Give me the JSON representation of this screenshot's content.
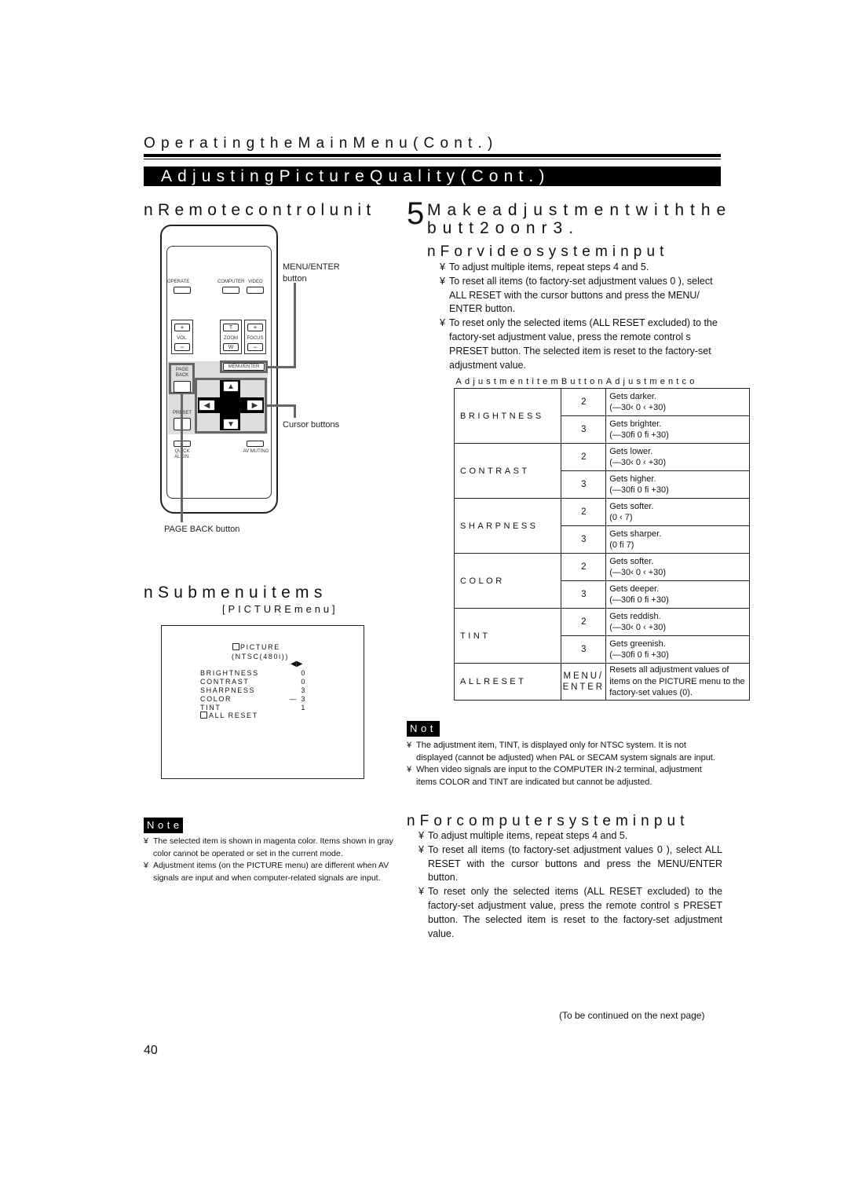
{
  "header": {
    "running_title": "OperatingtheMainMenu(Cont.)",
    "section_banner": "AdjustingPictureQuality(Cont.)"
  },
  "remote_section": {
    "heading": "nRemotecontrolunit",
    "buttons": {
      "operate": "OPERATE",
      "computer": "COMPUTER",
      "video": "VIDEO",
      "vol_plus": "+",
      "vol_label": "VOL.",
      "vol_minus": "−",
      "zoom_t": "T",
      "zoom_label": "ZOOM",
      "zoom_w": "W",
      "focus_plus": "+",
      "focus_label": "FOCUS",
      "focus_minus": "−",
      "menu_enter": "MENU/ENTER",
      "page_back": "PAGE BACK",
      "preset": "PRESET",
      "up": "▲",
      "down": "▼",
      "left": "◀",
      "right": "▶",
      "quick_align": "QUICK ALIGN.",
      "av_muting": "AV MUTING"
    },
    "callouts": {
      "menu_enter_line1": "MENU/ENTER",
      "menu_enter_line2": "button",
      "cursor": "Cursor buttons",
      "page_back": "PAGE BACK button"
    }
  },
  "step": {
    "number": "5",
    "title_line1": "Makeadjustmentwiththe",
    "title_line2": "butt2oonr3."
  },
  "video_input": {
    "heading": "nForvideosysteminput",
    "bullet_symbol": "¥",
    "bullets": [
      "To adjust multiple items, repeat steps 4 and 5.",
      "To reset all items (to factory-set adjustment values  0 ), select ALL RESET with the cursor buttons and press the MENU/ ENTER button.",
      "To reset only the selected items (ALL RESET excluded) to the factory-set adjustment value, press the remote control s PRESET button. The selected item is reset to the factory-set adjustment value."
    ]
  },
  "table": {
    "headers": [
      "Adjustmentitem",
      "Button",
      "Adjustmentco"
    ],
    "rows": [
      {
        "item": "BRIGHTNESS",
        "entries": [
          {
            "button": "2",
            "result": "Gets darker.",
            "range": "(—30‹  0 ‹  +30)"
          },
          {
            "button": "3",
            "result": "Gets brighter.",
            "range": "(—30fi  0 fi  +30)"
          }
        ]
      },
      {
        "item": "CONTRAST",
        "entries": [
          {
            "button": "2",
            "result": "Gets lower.",
            "range": "(—30‹  0 ‹  +30)"
          },
          {
            "button": "3",
            "result": "Gets higher.",
            "range": "(—30fi  0 fi  +30)"
          }
        ]
      },
      {
        "item": "SHARPNESS",
        "entries": [
          {
            "button": "2",
            "result": "Gets softer.",
            "range": "(0 ‹  7)"
          },
          {
            "button": "3",
            "result": "Gets sharper.",
            "range": "(0 fi  7)"
          }
        ]
      },
      {
        "item": "COLOR",
        "entries": [
          {
            "button": "2",
            "result": "Gets softer.",
            "range": "(—30‹  0 ‹  +30)"
          },
          {
            "button": "3",
            "result": "Gets deeper.",
            "range": "(—30fi  0 fi  +30)"
          }
        ]
      },
      {
        "item": "TINT",
        "entries": [
          {
            "button": "2",
            "result": "Gets reddish.",
            "range": "(—30‹  0 ‹  +30)"
          },
          {
            "button": "3",
            "result": "Gets greenish.",
            "range": "(—30fi  0 fi  +30)"
          }
        ]
      }
    ],
    "all_reset": {
      "item": "ALLRESET",
      "button_line1": "MENU/",
      "button_line2": "ENTER",
      "result": "Resets all adjustment values of items on the PICTURE menu to the factory-set values (0)."
    }
  },
  "video_note": {
    "badge": "Not",
    "bullets": [
      "The adjustment item, TINT, is displayed only for NTSC system. It is not displayed (cannot be adjusted) when PAL or SECAM system signals are input.",
      "When video signals are input to the COMPUTER IN-2 terminal, adjustment items  COLOR  and  TINT  are indicated but cannot be adjusted."
    ]
  },
  "submenu": {
    "heading": "nSubmenuitems",
    "subheading": "[PICTUREmenu]",
    "osd": {
      "title": "PICTURE",
      "signal": "(NTSC(480i))",
      "arrows": "◀▶",
      "items": [
        {
          "label": "BRIGHTNESS",
          "value": "0"
        },
        {
          "label": "CONTRAST",
          "value": "0"
        },
        {
          "label": "SHARPNESS",
          "value": "3"
        },
        {
          "label": "COLOR",
          "value": "— 3"
        },
        {
          "label": "TINT",
          "value": "1"
        }
      ],
      "all_reset": "ALL RESET"
    }
  },
  "left_note": {
    "badge": "Note",
    "bullets": [
      "The selected item is shown in magenta color. Items shown in gray color cannot be operated or set in the current mode.",
      "Adjustment items (on the PICTURE menu) are different when AV signals are input and when computer-related signals are input."
    ]
  },
  "computer_input": {
    "heading": "nForcomputersysteminput",
    "bullets": [
      "To adjust multiple items, repeat steps 4 and 5.",
      "To reset all items (to factory-set adjustment values  0 ), select ALL RESET with the cursor buttons and press the MENU/ENTER button.",
      "To reset only the selected items (ALL RESET excluded) to the factory-set adjustment value, press the remote control s PRESET button. The selected item is reset to the factory-set adjustment value."
    ]
  },
  "footer": {
    "continued": "(To be continued on the next page)",
    "page_number": "40"
  }
}
